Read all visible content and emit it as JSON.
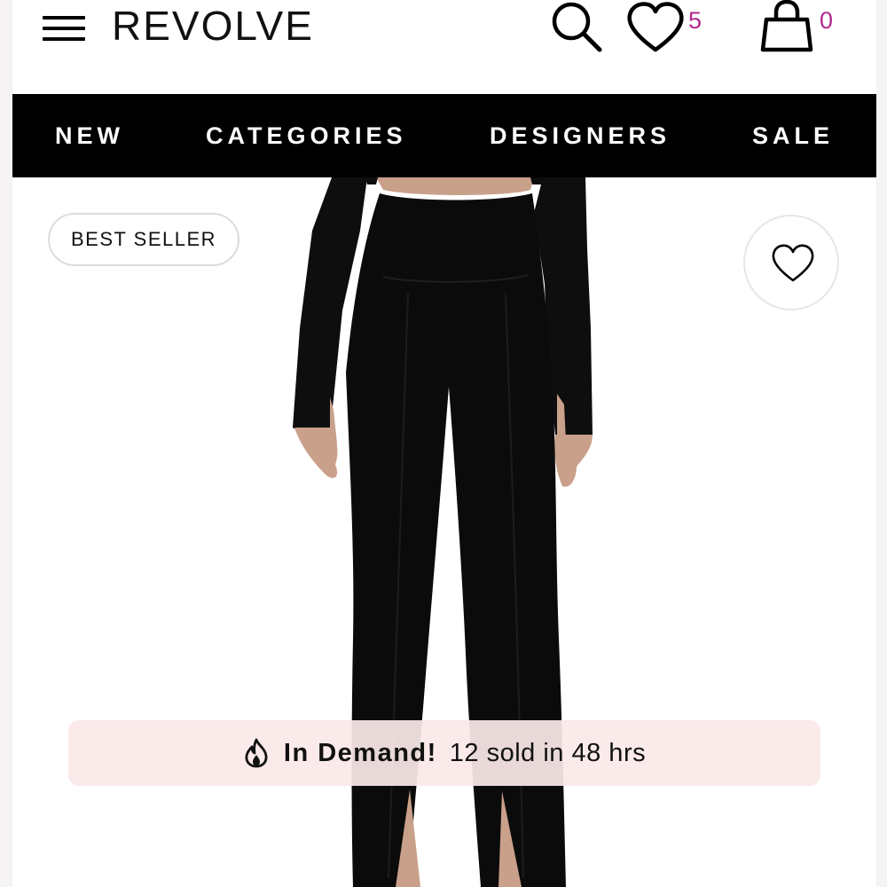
{
  "header": {
    "logo": "REVOLVE",
    "wishlist_count": "5",
    "bag_count": "0"
  },
  "nav": {
    "items": [
      {
        "label": "NEW"
      },
      {
        "label": "CATEGORIES"
      },
      {
        "label": "DESIGNERS"
      },
      {
        "label": "SALE"
      }
    ]
  },
  "product": {
    "badge": "BEST SELLER",
    "demand": {
      "title": "In Demand!",
      "text": "12 sold in 48 hrs"
    }
  },
  "icons": {
    "menu": "menu-icon",
    "search": "search-icon",
    "wishlist": "heart-icon",
    "bag": "shopping-bag-icon",
    "favorite": "heart-icon",
    "demand": "flame-icon"
  },
  "colors": {
    "accent": "#b5288f",
    "navbar": "#000000",
    "demand_bg": "#fae8e8"
  }
}
